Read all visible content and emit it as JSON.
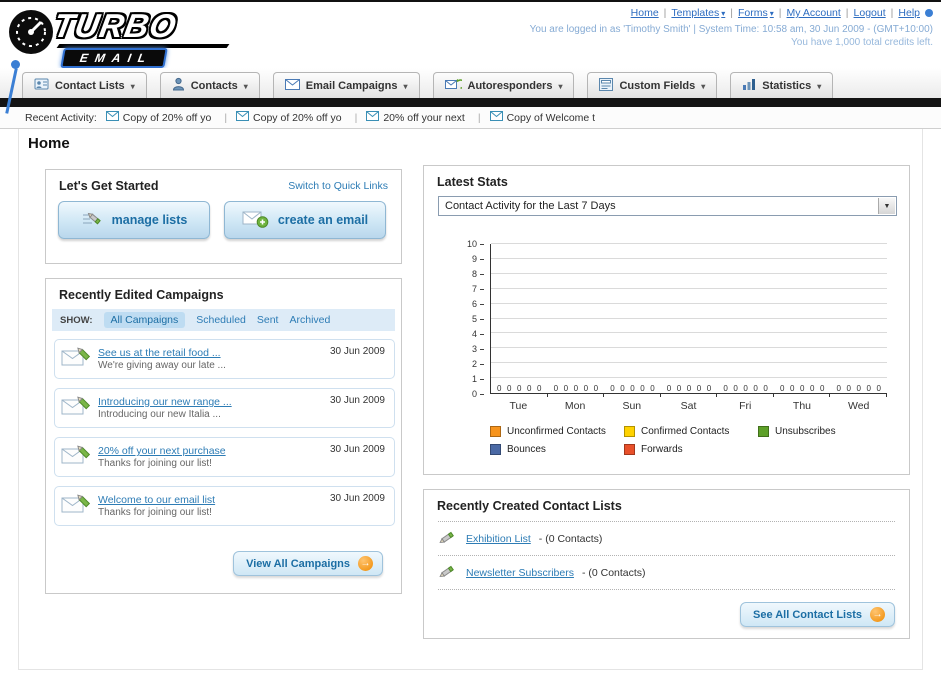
{
  "header": {
    "logo": {
      "title": "TURBO",
      "subtitle": "EMAIL"
    },
    "links": [
      {
        "label": "Home"
      },
      {
        "label": "Templates"
      },
      {
        "label": "Forms"
      },
      {
        "label": "My Account"
      },
      {
        "label": "Logout"
      },
      {
        "label": "Help"
      }
    ],
    "login_status": "You are logged in as 'Timothy Smith' | System Time: 10:58 am, 30 Jun 2009 - (GMT+10:00)",
    "credits_note": "You have 1,000 total credits left."
  },
  "nav": {
    "tabs": [
      {
        "label": "Contact Lists"
      },
      {
        "label": "Contacts"
      },
      {
        "label": "Email Campaigns"
      },
      {
        "label": "Autoresponders"
      },
      {
        "label": "Custom Fields"
      },
      {
        "label": "Statistics"
      }
    ]
  },
  "recent_activity": {
    "label": "Recent Activity:",
    "items": [
      {
        "title": "Copy of 20% off yo"
      },
      {
        "title": "Copy of 20% off yo"
      },
      {
        "title": "20% off your next"
      },
      {
        "title": "Copy of Welcome t"
      }
    ]
  },
  "page": {
    "title": "Home"
  },
  "get_started": {
    "title": "Let's Get Started",
    "switch_link": "Switch to Quick Links",
    "manage_lists_label": "manage lists",
    "create_email_label": "create an email"
  },
  "campaigns": {
    "title": "Recently Edited Campaigns",
    "show_label": "SHOW:",
    "filters": [
      {
        "label": "All Campaigns"
      },
      {
        "label": "Scheduled"
      },
      {
        "label": "Sent"
      },
      {
        "label": "Archived"
      }
    ],
    "items": [
      {
        "title": "See us at the retail food ...",
        "subtitle": "We're giving away our late ...",
        "date": "30 Jun 2009"
      },
      {
        "title": "Introducing our new range ...",
        "subtitle": "Introducing our new Italia ...",
        "date": "30 Jun 2009"
      },
      {
        "title": "20% off your next purchase",
        "subtitle": "Thanks for joining our list!",
        "date": "30 Jun 2009"
      },
      {
        "title": "Welcome to our email list",
        "subtitle": "Thanks for joining our list!",
        "date": "30 Jun 2009"
      }
    ],
    "view_all_label": "View All Campaigns"
  },
  "stats": {
    "title": "Latest Stats",
    "period_selector": "Contact Activity for the Last 7 Days",
    "chart_data": {
      "type": "bar",
      "categories": [
        "Tue",
        "Mon",
        "Sun",
        "Sat",
        "Fri",
        "Thu",
        "Wed"
      ],
      "series": [
        {
          "name": "Unconfirmed Contacts",
          "color": "#f7941d",
          "values": [
            0,
            0,
            0,
            0,
            0,
            0,
            0
          ]
        },
        {
          "name": "Confirmed Contacts",
          "color": "#ffd200",
          "values": [
            0,
            0,
            0,
            0,
            0,
            0,
            0
          ]
        },
        {
          "name": "Unsubscribes",
          "color": "#5da028",
          "values": [
            0,
            0,
            0,
            0,
            0,
            0,
            0
          ]
        },
        {
          "name": "Bounces",
          "color": "#4a69a5",
          "values": [
            0,
            0,
            0,
            0,
            0,
            0,
            0
          ]
        },
        {
          "name": "Forwards",
          "color": "#e8502a",
          "values": [
            0,
            0,
            0,
            0,
            0,
            0,
            0
          ]
        }
      ],
      "ylim": [
        0,
        10
      ],
      "y_tick_step": 1,
      "grid": true,
      "legend_position": "bottom",
      "data_labels": true,
      "title": "Contact Activity for the Last 7 Days",
      "xlabel": "",
      "ylabel": ""
    }
  },
  "contact_lists": {
    "title": "Recently Created Contact Lists",
    "items": [
      {
        "name": "Exhibition List",
        "suffix": " - (0 Contacts)"
      },
      {
        "name": "Newsletter Subscribers",
        "suffix": " - (0 Contacts)"
      }
    ],
    "see_all_label": "See All Contact Lists"
  },
  "colors": {
    "link_blue": "#2d7cb5",
    "accent_orange": "#f7941d",
    "dark_bar": "#141414"
  }
}
